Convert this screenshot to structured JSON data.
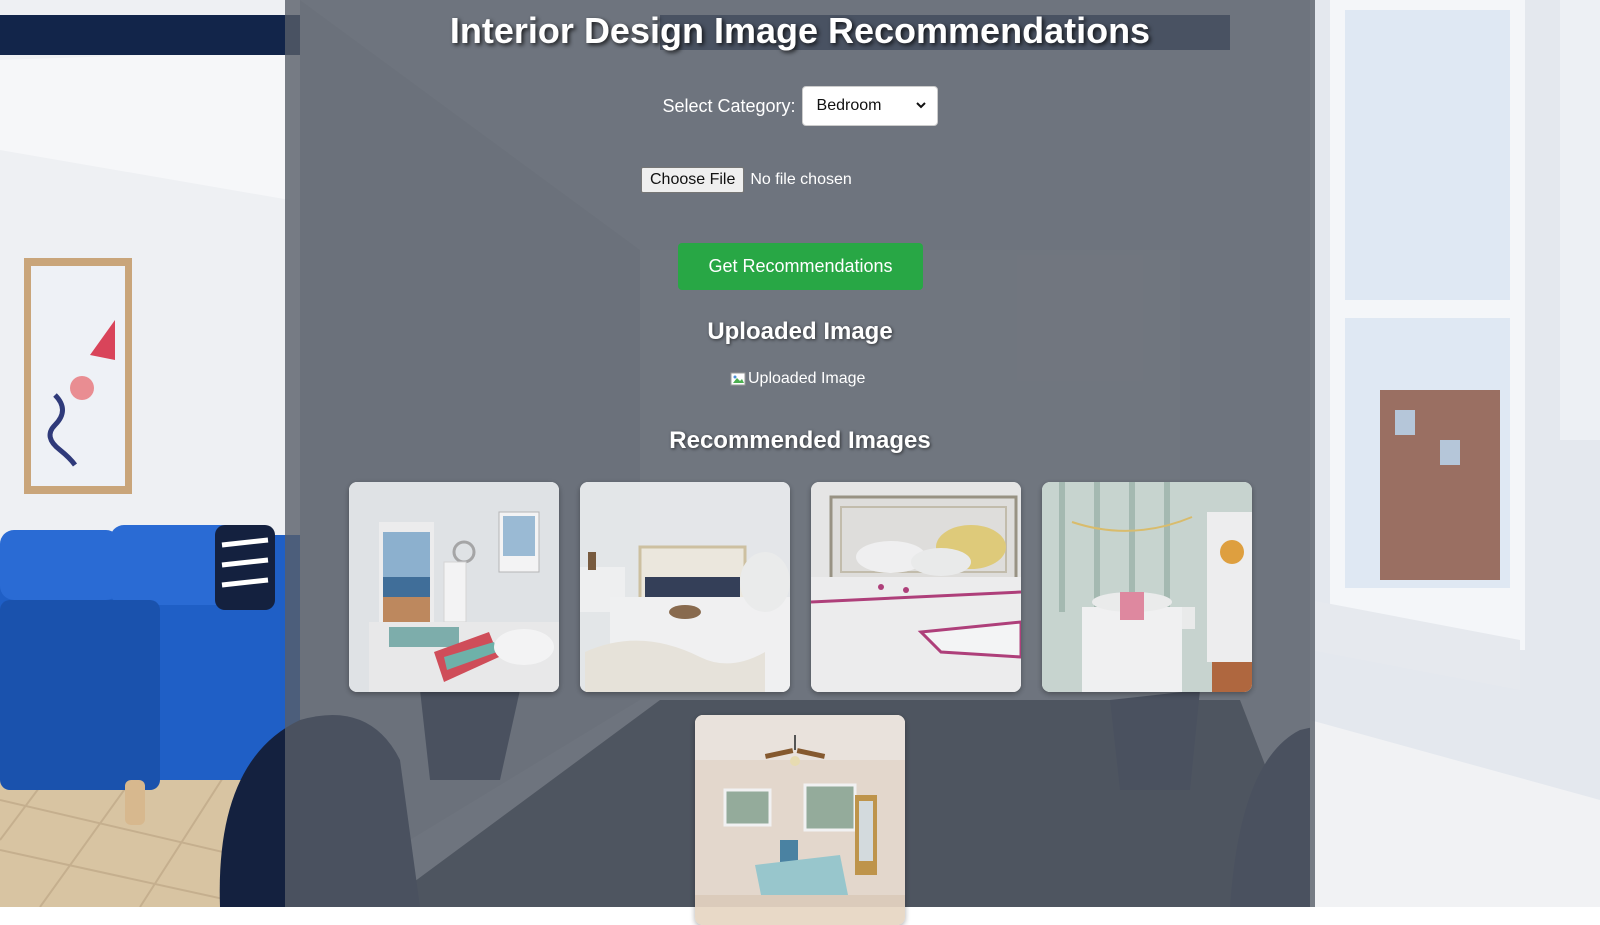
{
  "page": {
    "title": "Interior Design Image Recommendations"
  },
  "category": {
    "label": "Select Category:",
    "selected": "Bedroom"
  },
  "file_input": {
    "button_label": "Choose File",
    "status_text": "No file chosen"
  },
  "actions": {
    "recommend_label": "Get Recommendations"
  },
  "uploaded": {
    "heading": "Uploaded Image",
    "alt_text": "Uploaded Image"
  },
  "recommended": {
    "heading": "Recommended Images",
    "images": [
      {
        "icon": "bedroom-photo-1"
      },
      {
        "icon": "bedroom-photo-2"
      },
      {
        "icon": "bedroom-photo-3"
      },
      {
        "icon": "bedroom-photo-4"
      },
      {
        "icon": "bedroom-photo-5"
      }
    ]
  },
  "colors": {
    "accent_green": "#28a745",
    "panel_overlay": "#585e68",
    "sofa_blue": "#1f5fc6"
  }
}
